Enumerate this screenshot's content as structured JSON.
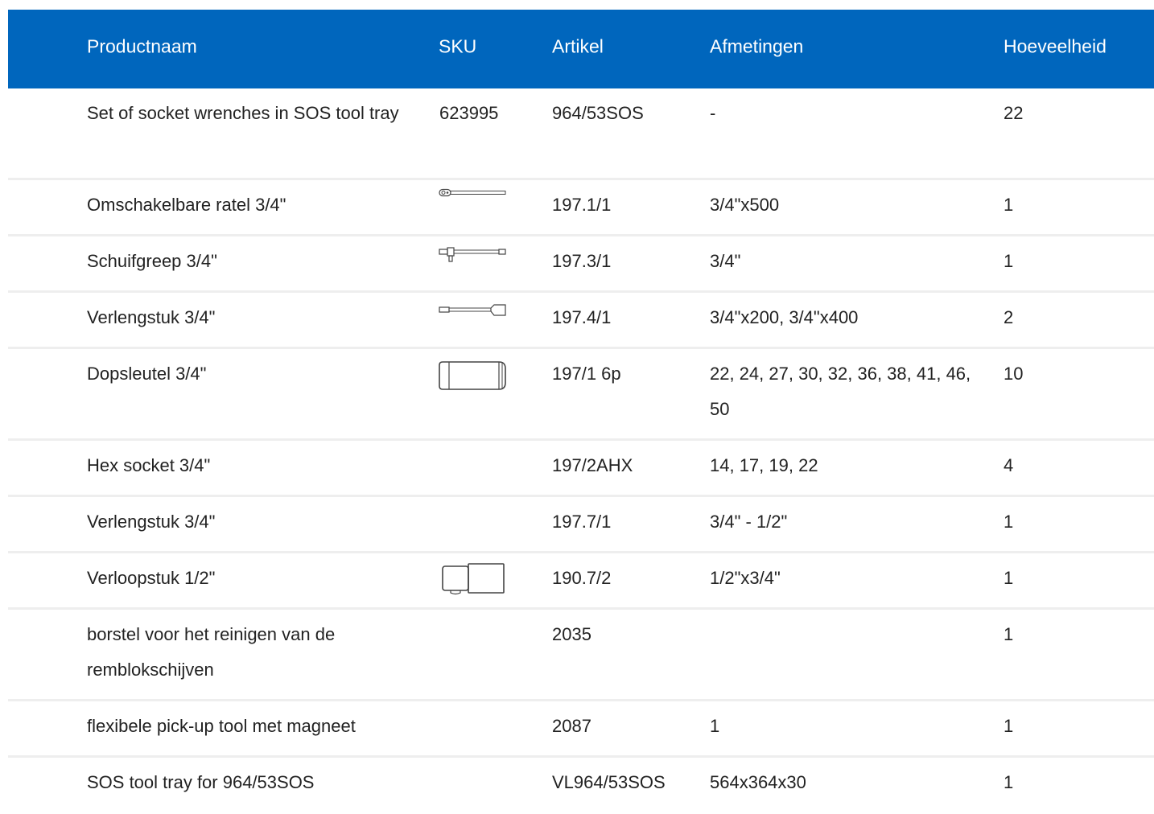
{
  "header": {
    "productnaam": "Productnaam",
    "sku": "SKU",
    "artikel": "Artikel",
    "afmetingen": "Afmetingen",
    "hoeveelheid": "Hoeveelheid"
  },
  "rows": [
    {
      "name": "Set of socket wrenches in SOS tool tray",
      "sku": "623995",
      "artikel": "964/53SOS",
      "afmetingen": "-",
      "qty": "22"
    },
    {
      "name": "Omschakelbare ratel 3/4\"",
      "icon": "ratchet-icon",
      "artikel": "197.1/1",
      "afmetingen": "3/4\"x500",
      "qty": "1"
    },
    {
      "name": "Schuifgreep 3/4\"",
      "icon": "sliding-t-handle-icon",
      "artikel": "197.3/1",
      "afmetingen": "3/4\"",
      "qty": "1"
    },
    {
      "name": "Verlengstuk 3/4\"",
      "icon": "extension-bar-icon",
      "artikel": "197.4/1",
      "afmetingen": "3/4\"x200, 3/4\"x400",
      "qty": "2"
    },
    {
      "name": "Dopsleutel 3/4\"",
      "icon": "socket-icon",
      "artikel": "197/1 6p",
      "afmetingen": "22, 24, 27, 30, 32, 36, 38, 41, 46, 50",
      "qty": "10"
    },
    {
      "name": "Hex socket 3/4\"",
      "artikel": "197/2AHX",
      "afmetingen": "14, 17, 19, 22",
      "qty": "4"
    },
    {
      "name": "Verlengstuk 3/4\"",
      "artikel": "197.7/1",
      "afmetingen": "3/4\" - 1/2\"",
      "qty": "1"
    },
    {
      "name": "Verloopstuk 1/2\"",
      "icon": "adapter-icon",
      "artikel": "190.7/2",
      "afmetingen": "1/2\"x3/4\"",
      "qty": "1"
    },
    {
      "name": "borstel voor het reinigen van de remblokschijven",
      "artikel": "2035",
      "afmetingen": "",
      "qty": "1"
    },
    {
      "name": "flexibele pick-up tool met magneet",
      "artikel": "2087",
      "afmetingen": "1",
      "qty": "1"
    },
    {
      "name": "SOS tool tray for 964/53SOS",
      "artikel": "VL964/53SOS",
      "afmetingen": "564x364x30",
      "qty": "1"
    }
  ]
}
